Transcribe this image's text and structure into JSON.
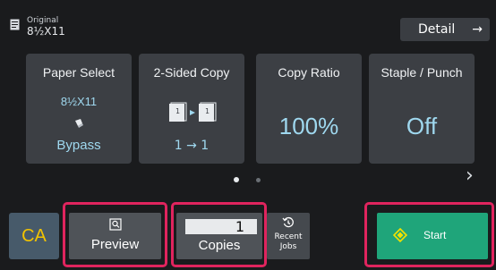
{
  "header": {
    "original_label": "Original",
    "original_size": "8½X11",
    "detail_label": "Detail",
    "detail_arrow": "→"
  },
  "tiles": [
    {
      "title": "Paper Select",
      "size": "8½X11",
      "source": "Bypass",
      "icon": "paper-tray-icon"
    },
    {
      "title": "2-Sided Copy",
      "mode": "1 → 1",
      "icon": "duplex-pages-icon"
    },
    {
      "title": "Copy Ratio",
      "value": "100%"
    },
    {
      "title": "Staple / Punch",
      "value": "Off"
    }
  ],
  "pager": {
    "pages": 2,
    "current": 1
  },
  "nav_next": "›",
  "bottom": {
    "ca_label": "CA",
    "preview_label": "Preview",
    "copies_value": "1",
    "copies_label": "Copies",
    "recent_line1": "Recent",
    "recent_line2": "Jobs",
    "start_label": "Start"
  },
  "colors": {
    "accent_text": "#9fd8ef",
    "highlight": "#e0245e",
    "start": "#1fa57a",
    "ca_text": "#f2c300"
  }
}
